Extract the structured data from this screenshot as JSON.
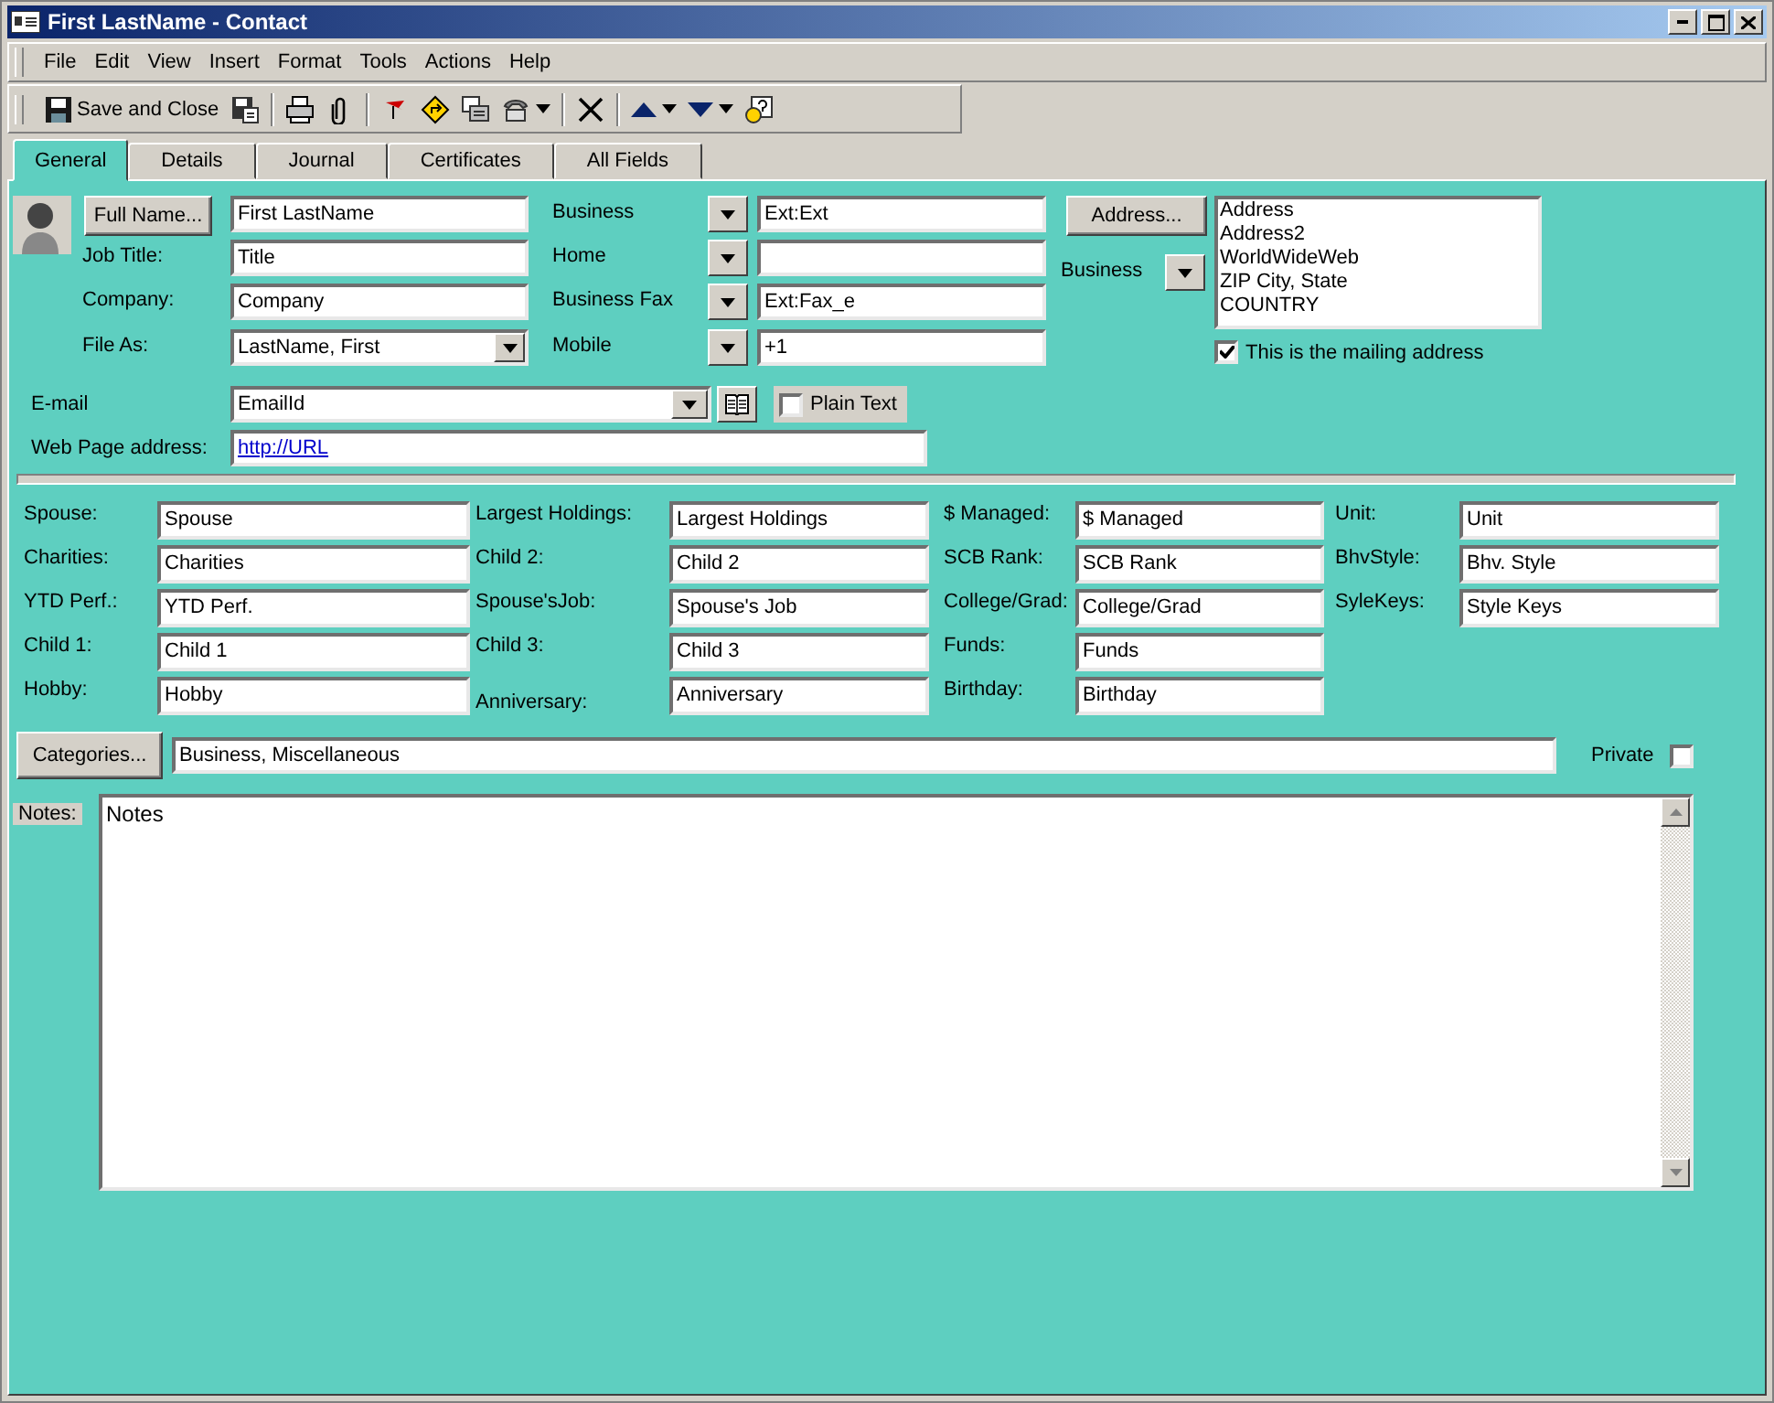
{
  "window": {
    "title": "First LastName - Contact"
  },
  "menu": [
    "File",
    "Edit",
    "View",
    "Insert",
    "Format",
    "Tools",
    "Actions",
    "Help"
  ],
  "toolbar": {
    "save_label": "Save and Close"
  },
  "tabs": [
    {
      "label": "General",
      "selected": true
    },
    {
      "label": "Details",
      "selected": false
    },
    {
      "label": "Journal",
      "selected": false
    },
    {
      "label": "Certificates",
      "selected": false
    },
    {
      "label": "All Fields",
      "selected": false
    }
  ],
  "name_fields": [
    {
      "kind": "button",
      "label": "Full Name...",
      "value": "First LastName"
    },
    {
      "kind": "text",
      "label": "Job Title:",
      "value": "Title"
    },
    {
      "kind": "text",
      "label": "Company:",
      "value": "Company"
    },
    {
      "kind": "combo",
      "label": "File As:",
      "value": "LastName, First"
    }
  ],
  "phones": [
    {
      "label": "Business",
      "value": "Ext:Ext"
    },
    {
      "label": "Home"
    },
    {
      "label": "Business Fax",
      "value": "Ext:Fax_e"
    },
    {
      "label": "Mobile",
      "value": "+1"
    }
  ],
  "address": {
    "button": "Address...",
    "type": "Business",
    "lines": [
      "Address",
      "Address2",
      "WorldWideWeb",
      "ZIP  City, State",
      "COUNTRY"
    ],
    "mailing": {
      "label": "This is the mailing address",
      "checked": true
    }
  },
  "email": {
    "label": "E-mail",
    "value": "EmailId",
    "plain_text": {
      "label": "Plain Text",
      "checked": false
    }
  },
  "web": {
    "label": "Web Page address:",
    "value": "http://URL"
  },
  "custom_fields": [
    [
      {
        "label": "Spouse:",
        "value": "Spouse"
      },
      {
        "label": "Charities:",
        "value": "Charities"
      },
      {
        "label": "YTD Perf.:",
        "value": "YTD Perf."
      },
      {
        "label": "Child 1:",
        "value": "Child 1"
      },
      {
        "label": "Hobby:",
        "value": "Hobby"
      }
    ],
    [
      {
        "label": "Largest Holdings:",
        "value": "Largest Holdings"
      },
      {
        "label": "Child 2:",
        "value": "Child 2"
      },
      {
        "label": "Spouse'sJob:",
        "value": "Spouse's Job"
      },
      {
        "label": "Child 3:",
        "value": "Child 3"
      },
      {
        "label": "Anniversary:",
        "value": "Anniversary"
      }
    ],
    [
      {
        "label": "$ Managed:",
        "value": "$ Managed"
      },
      {
        "label": "SCB Rank:",
        "value": "SCB Rank"
      },
      {
        "label": "College/Grad:",
        "value": "College/Grad"
      },
      {
        "label": "Funds:",
        "value": "Funds"
      },
      {
        "label": "Birthday:",
        "value": "Birthday"
      }
    ],
    [
      {
        "label": "Unit:",
        "value": "Unit"
      },
      {
        "label": "BhvStyle:",
        "value": "Bhv. Style"
      },
      {
        "label": "SyleKeys:",
        "value": "Style Keys"
      }
    ]
  ],
  "categories": {
    "button": "Categories...",
    "value": "Business, Miscellaneous"
  },
  "private": {
    "label": "Private",
    "checked": false
  },
  "notes": {
    "label": "Notes:",
    "value": "Notes"
  }
}
